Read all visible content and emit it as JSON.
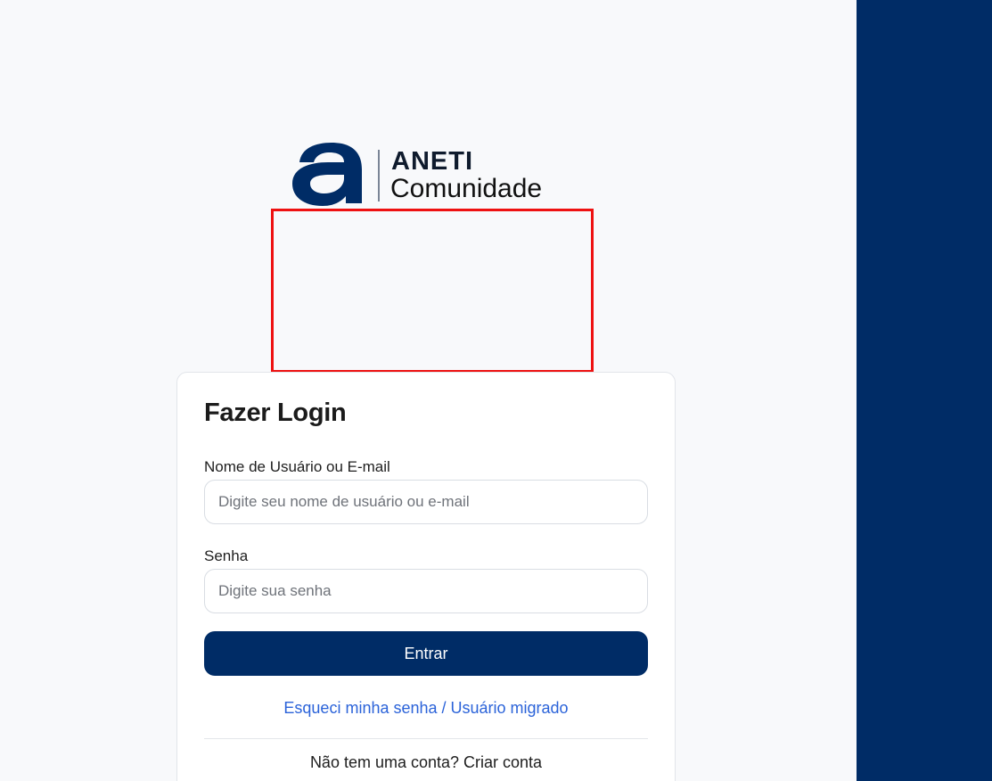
{
  "logo": {
    "brand": "ANETI",
    "subtitle": "Comunidade",
    "colors": {
      "mark": "#002c66",
      "divider": "#7a8596"
    }
  },
  "login_form": {
    "title": "Fazer Login",
    "username_label": "Nome de Usuário ou E-mail",
    "username_value": "",
    "username_placeholder": "Digite seu nome de usuário ou e-mail",
    "password_label": "Senha",
    "password_value": "",
    "password_placeholder": "Digite sua senha",
    "submit_label": "Entrar",
    "forgot_link": "Esqueci minha senha / Usuário migrado",
    "signup_prompt": "Não tem uma conta?",
    "signup_link": "Criar conta"
  },
  "colors": {
    "primary": "#002c66",
    "link": "#2b63d9",
    "background": "#f8f9fb",
    "highlight": "#ee1111"
  }
}
